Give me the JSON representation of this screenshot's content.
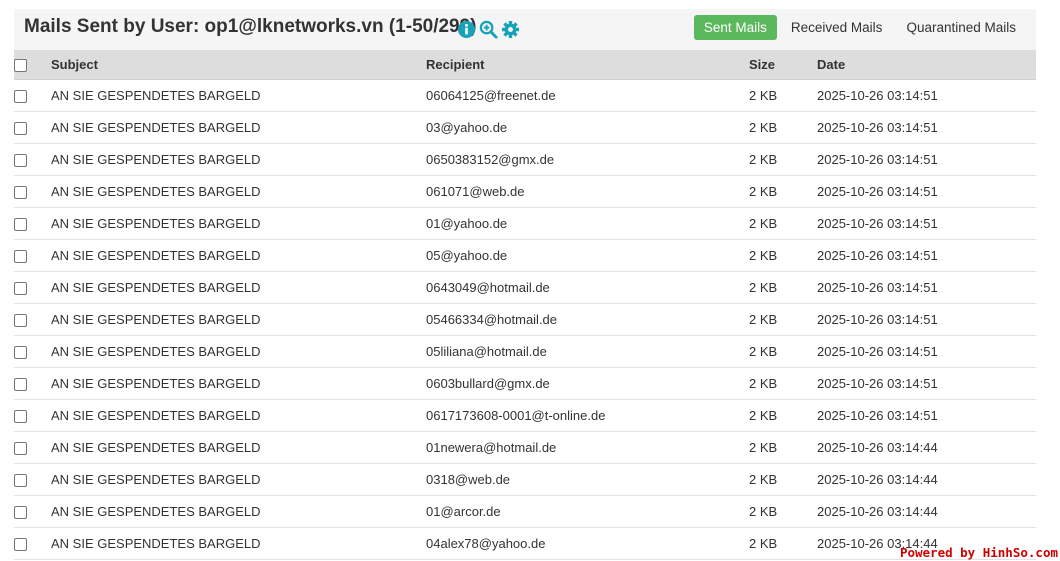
{
  "header": {
    "title": "Mails Sent by User: op1@lknetworks.vn (1-50/299)",
    "icons": [
      "info-icon",
      "zoom-in-icon",
      "gear-icon"
    ],
    "accent_color": "#17a2b8",
    "tabs": [
      {
        "label": "Sent Mails",
        "active": true
      },
      {
        "label": "Received Mails",
        "active": false
      },
      {
        "label": "Quarantined Mails",
        "active": false
      }
    ],
    "active_tab_color": "#5cb85c"
  },
  "table": {
    "columns": {
      "subject": "Subject",
      "recipient": "Recipient",
      "size": "Size",
      "date": "Date"
    },
    "rows": [
      {
        "subject": "AN SIE GESPENDETES BARGELD",
        "recipient": "06064125@freenet.de",
        "size": "2 KB",
        "date": "2025-10-26 03:14:51"
      },
      {
        "subject": "AN SIE GESPENDETES BARGELD",
        "recipient": "03@yahoo.de",
        "size": "2 KB",
        "date": "2025-10-26 03:14:51"
      },
      {
        "subject": "AN SIE GESPENDETES BARGELD",
        "recipient": "0650383152@gmx.de",
        "size": "2 KB",
        "date": "2025-10-26 03:14:51"
      },
      {
        "subject": "AN SIE GESPENDETES BARGELD",
        "recipient": "061071@web.de",
        "size": "2 KB",
        "date": "2025-10-26 03:14:51"
      },
      {
        "subject": "AN SIE GESPENDETES BARGELD",
        "recipient": "01@yahoo.de",
        "size": "2 KB",
        "date": "2025-10-26 03:14:51"
      },
      {
        "subject": "AN SIE GESPENDETES BARGELD",
        "recipient": "05@yahoo.de",
        "size": "2 KB",
        "date": "2025-10-26 03:14:51"
      },
      {
        "subject": "AN SIE GESPENDETES BARGELD",
        "recipient": "0643049@hotmail.de",
        "size": "2 KB",
        "date": "2025-10-26 03:14:51"
      },
      {
        "subject": "AN SIE GESPENDETES BARGELD",
        "recipient": "05466334@hotmail.de",
        "size": "2 KB",
        "date": "2025-10-26 03:14:51"
      },
      {
        "subject": "AN SIE GESPENDETES BARGELD",
        "recipient": "05liliana@hotmail.de",
        "size": "2 KB",
        "date": "2025-10-26 03:14:51"
      },
      {
        "subject": "AN SIE GESPENDETES BARGELD",
        "recipient": "0603bullard@gmx.de",
        "size": "2 KB",
        "date": "2025-10-26 03:14:51"
      },
      {
        "subject": "AN SIE GESPENDETES BARGELD",
        "recipient": "0617173608-0001@t-online.de",
        "size": "2 KB",
        "date": "2025-10-26 03:14:51"
      },
      {
        "subject": "AN SIE GESPENDETES BARGELD",
        "recipient": "01newera@hotmail.de",
        "size": "2 KB",
        "date": "2025-10-26 03:14:44"
      },
      {
        "subject": "AN SIE GESPENDETES BARGELD",
        "recipient": "0318@web.de",
        "size": "2 KB",
        "date": "2025-10-26 03:14:44"
      },
      {
        "subject": "AN SIE GESPENDETES BARGELD",
        "recipient": "01@arcor.de",
        "size": "2 KB",
        "date": "2025-10-26 03:14:44"
      },
      {
        "subject": "AN SIE GESPENDETES BARGELD",
        "recipient": "04alex78@yahoo.de",
        "size": "2 KB",
        "date": "2025-10-26 03:14:44"
      }
    ]
  },
  "watermark": "Powered by HinhSo.com"
}
